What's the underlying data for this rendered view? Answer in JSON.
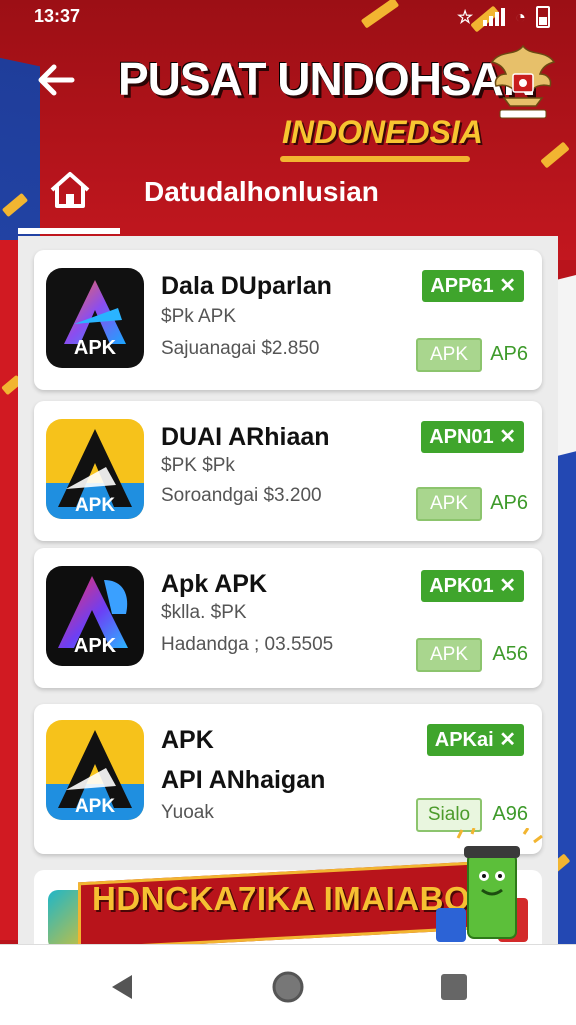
{
  "status_bar": {
    "time": "13:37"
  },
  "header": {
    "back_icon": "arrow-left-icon",
    "title": "PUSAT UNDOHSAN",
    "subtitle": "INDONEDSIA",
    "emblem_icon": "garuda-emblem-icon"
  },
  "tabs": {
    "home_icon": "home-icon",
    "label": "Datudalhonlusian"
  },
  "apps": [
    {
      "name": "Dala DUparlan",
      "line1": "$Pk APK",
      "line2": "Sajuanagai $2.850",
      "badge": "APP61 ✕",
      "apk_label": "APK",
      "version": "AP6",
      "icon": "apk-gradient-icon"
    },
    {
      "name": "DUAI ARhiaan",
      "line1": "$PK $Pk",
      "line2": "Soroandgai $3.200",
      "badge": "APN01 ✕",
      "apk_label": "APK",
      "version": "AP6",
      "icon": "apk-yellow-icon"
    },
    {
      "name": "Apk APK",
      "line1": "$klla. $PK",
      "line2": "Hadandga ; 03.5505",
      "badge": "APK01 ✕",
      "apk_label": "APK",
      "version": "A56",
      "icon": "apk-dark-icon"
    },
    {
      "name": "APK",
      "line1": "API ANhaigan",
      "line2": "Yuoak",
      "badge": "APKai ✕",
      "apk_label": "Sialo",
      "version": "A96",
      "icon": "apk-yellow-icon"
    }
  ],
  "promo": {
    "text": "HDNCKA7IKA IMAIABOIA!"
  },
  "navbar": {
    "back": "nav-back-icon",
    "home": "nav-home-icon",
    "recents": "nav-recents-icon"
  },
  "colors": {
    "primary_red": "#b9141c",
    "accent_gold": "#f2b531",
    "badge_green": "#3fa52c"
  }
}
